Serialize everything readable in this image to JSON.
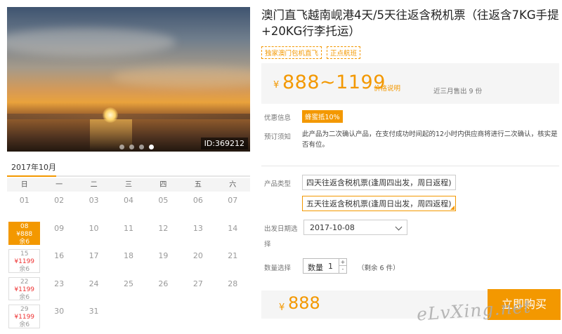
{
  "gallery": {
    "image_id": "ID:369212",
    "slide_count": 4,
    "active_slide": 4
  },
  "calendar": {
    "month_label": "2017年10月",
    "weekdays": [
      "日",
      "一",
      "二",
      "三",
      "四",
      "五",
      "六"
    ],
    "plain_days": [
      "01",
      "02",
      "03",
      "04",
      "05",
      "06",
      "07",
      "09",
      "10",
      "11",
      "12",
      "13",
      "14",
      "16",
      "17",
      "18",
      "19",
      "20",
      "21",
      "23",
      "24",
      "25",
      "26",
      "27",
      "28",
      "30",
      "31"
    ],
    "priced_days": [
      {
        "day": "08",
        "price": "¥888",
        "left": "余6",
        "selected": true
      },
      {
        "day": "15",
        "price": "¥1199",
        "left": "余6",
        "selected": false
      },
      {
        "day": "22",
        "price": "¥1199",
        "left": "余6",
        "selected": false
      },
      {
        "day": "29",
        "price": "¥1199",
        "left": "余6",
        "selected": false
      }
    ]
  },
  "product": {
    "title": "澳门直飞越南岘港4天/5天往返含税机票（往返含7KG手提+20KG行李托运）",
    "tags": [
      "独家澳门包机直飞",
      "正点航班"
    ],
    "price_currency": "¥",
    "price_range": "888~1199",
    "price_explain": "价格说明",
    "sold_text": "近三月售出 9 份"
  },
  "info": {
    "promo_label": "优惠信息",
    "promo_badge": "蜂蜜抵10%",
    "notice_label": "预订须知",
    "notice_text": "此产品为二次确认产品，在支付成功时间起的12小时内供应商将进行二次确认，核实是否有位。"
  },
  "options": {
    "type_label": "产品类型",
    "types": [
      "四天往返含税机票(逢周四出发，周日返程)",
      "五天往返含税机票(逢周日出发，周四返程)"
    ],
    "selected_type": 1,
    "date_label_line1": "出发日期选",
    "date_label_line2": "择",
    "date_value": "2017-10-08",
    "qty_label_row": "数量选择",
    "qty_field_label": "数量",
    "qty_value": "1",
    "stock_text": "（剩余 6 件）"
  },
  "checkout": {
    "currency": "¥",
    "total": "888",
    "buy_label": "立即购买"
  },
  "watermark": "eLvXing.net",
  "colors": {
    "accent": "#f39800",
    "price_red": "#e33333"
  }
}
